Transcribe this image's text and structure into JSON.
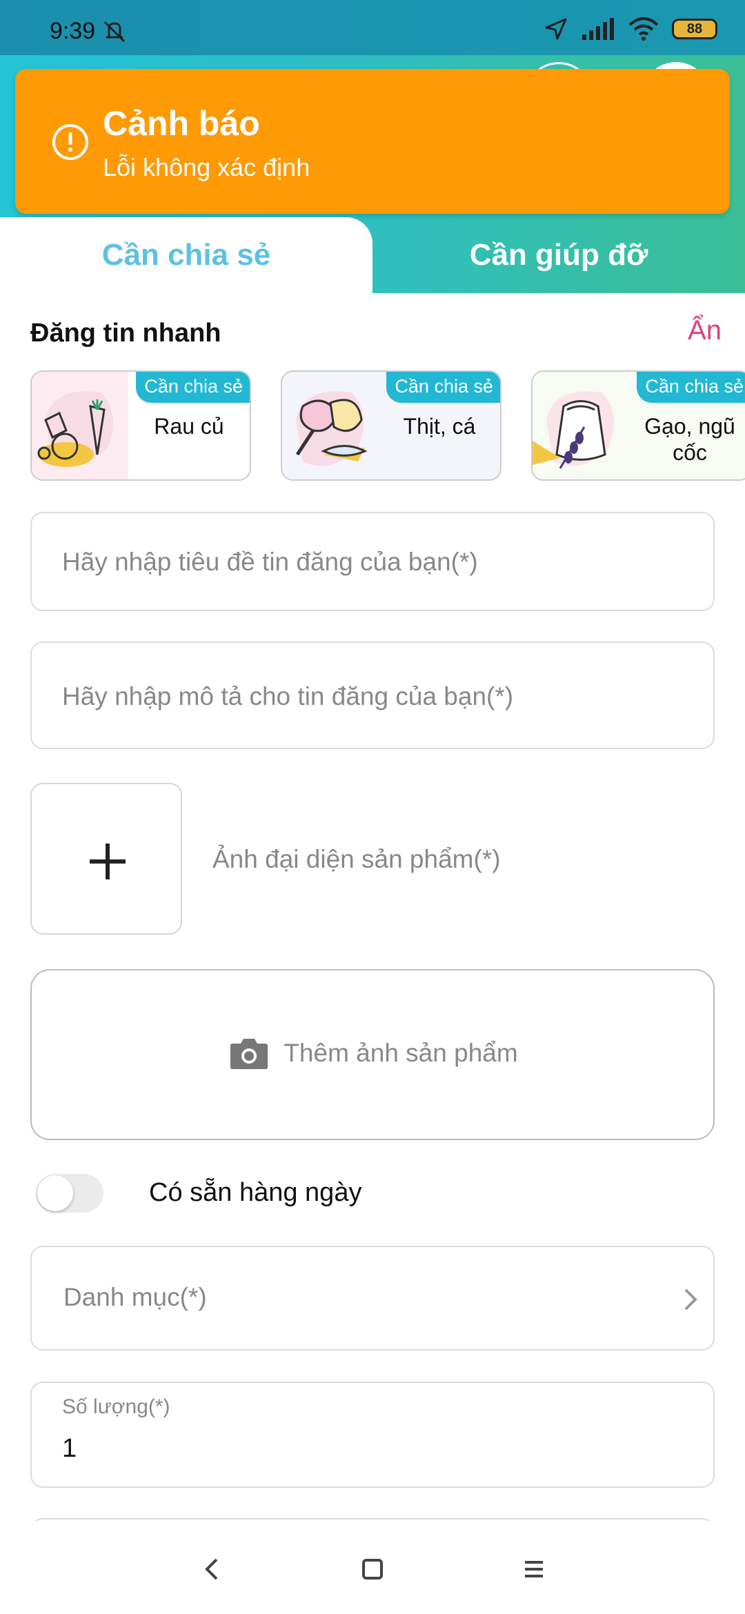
{
  "status_bar": {
    "time": "9:39",
    "battery": "88"
  },
  "alert": {
    "title": "Cảnh báo",
    "message": "Lỗi không xác định"
  },
  "tabs": [
    {
      "label": "Cần chia sẻ",
      "active": true
    },
    {
      "label": "Cần giúp đỡ",
      "active": false
    }
  ],
  "quick_post": {
    "title": "Đăng tin nhanh",
    "hide_label": "Ẩn",
    "cards": [
      {
        "badge": "Cần chia sẻ",
        "label": "Rau củ"
      },
      {
        "badge": "Cần chia sẻ",
        "label": "Thịt, cá"
      },
      {
        "badge": "Cần chia sẻ",
        "label": "Gạo, ngũ cốc"
      }
    ]
  },
  "form": {
    "title_placeholder": "Hãy nhập tiêu đề tin đăng của bạn(*)",
    "description_placeholder": "Hãy nhập mô tả cho tin đăng của bạn(*)",
    "cover_photo_label": "Ảnh đại diện sản phẩm(*)",
    "add_photos_label": "Thêm ảnh sản phẩm",
    "daily_available_label": "Có sẵn hàng ngày",
    "daily_available_on": false,
    "category_placeholder": "Danh mục(*)",
    "quantity_label": "Số lượng(*)",
    "quantity_value": "1"
  },
  "colors": {
    "accent_cyan": "#24c4d6",
    "accent_green": "#3cbf96",
    "alert_orange": "#fd9a05",
    "tab_active_text": "#5cc1e3",
    "hide_link": "#e0407c",
    "badge_bg": "#22b8d3"
  }
}
